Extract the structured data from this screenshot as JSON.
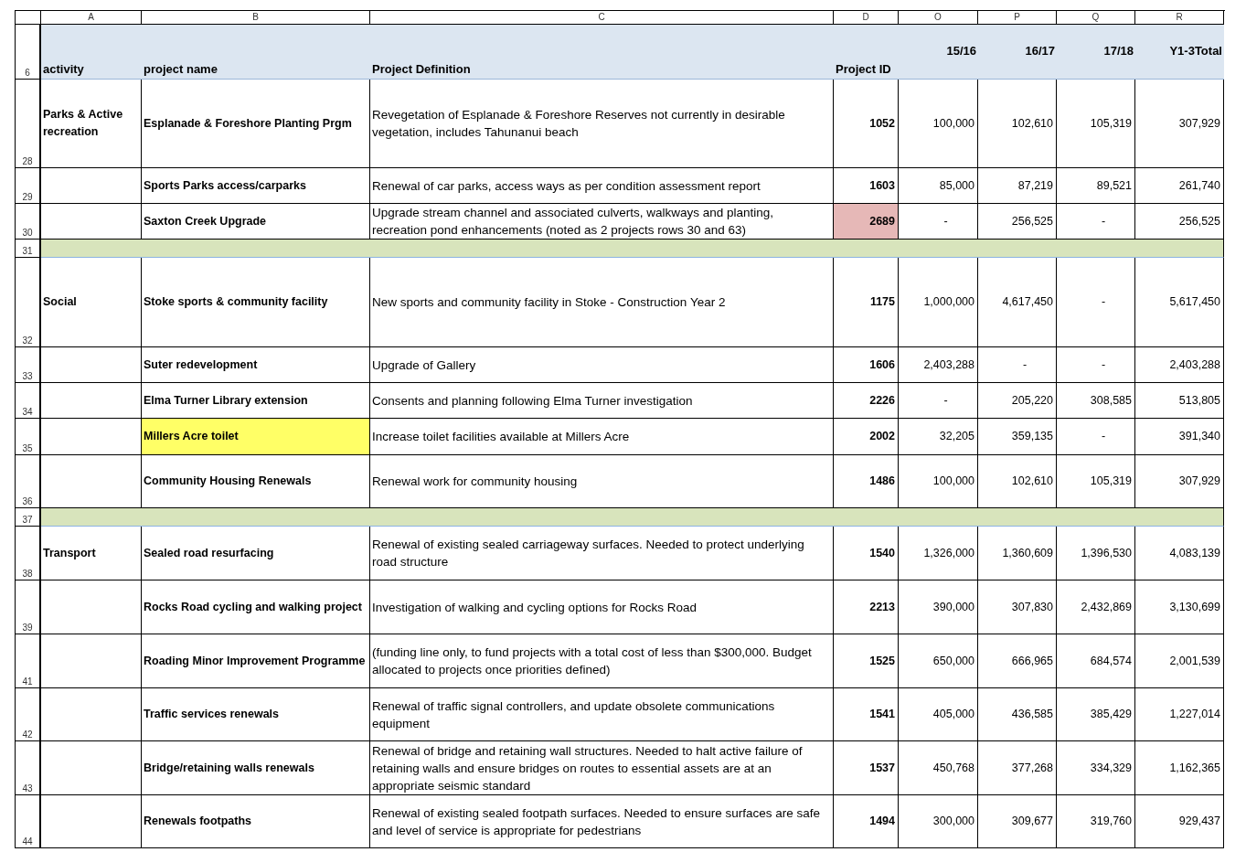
{
  "column_letters": [
    "A",
    "B",
    "C",
    "D",
    "O",
    "P",
    "Q",
    "R"
  ],
  "header": {
    "number": "6",
    "labels": [
      "activity",
      "project name",
      "Project Definition",
      "Project ID"
    ],
    "years": [
      "15/16",
      "16/17",
      "17/18",
      "Y1-3Total"
    ]
  },
  "rows": [
    {
      "kind": "data",
      "number": "28",
      "activity": "Parks & Active recreation",
      "project": {
        "text": "Esplanade & Foreshore Planting Prgm"
      },
      "definition": "Revegetation of Esplanade & Foreshore Reserves not currently in desirable vegetation, includes Tahunanui beach",
      "project_id": {
        "text": "1052"
      },
      "amounts": [
        "100,000",
        "102,610",
        "105,319",
        "307,929"
      ]
    },
    {
      "kind": "data",
      "number": "29",
      "project": {
        "text": "Sports Parks access/carparks"
      },
      "definition": "Renewal of car parks, access ways as per condition assessment report",
      "project_id": {
        "text": "1603"
      },
      "amounts": [
        "85,000",
        "87,219",
        "89,521",
        "261,740"
      ]
    },
    {
      "kind": "data",
      "number": "30",
      "project": {
        "text": "Saxton Creek Upgrade"
      },
      "definition": "Upgrade stream channel and associated culverts, walkways and planting, recreation pond enhancements (noted as 2 projects rows 30 and 63)",
      "project_id": {
        "text": "2689",
        "color": "#e6b8b7"
      },
      "amounts": [
        "-",
        "256,525",
        "-",
        "256,525"
      ]
    },
    {
      "kind": "separator",
      "number": "31"
    },
    {
      "kind": "data",
      "number": "32",
      "activity": "Social",
      "project": {
        "text": "Stoke sports & community facility"
      },
      "definition": "New sports and community facility in Stoke - Construction Year 2",
      "project_id": {
        "text": "1175"
      },
      "amounts": [
        "1,000,000",
        "4,617,450",
        "-",
        "5,617,450"
      ]
    },
    {
      "kind": "data",
      "number": "33",
      "project": {
        "text": "Suter redevelopment"
      },
      "definition": "Upgrade of Gallery",
      "project_id": {
        "text": "1606"
      },
      "amounts": [
        "2,403,288",
        "-",
        "-",
        "2,403,288"
      ]
    },
    {
      "kind": "data",
      "number": "34",
      "project": {
        "text": "Elma Turner Library extension"
      },
      "definition": "Consents and planning following Elma Turner investigation",
      "project_id": {
        "text": "2226"
      },
      "amounts": [
        "-",
        "205,220",
        "308,585",
        "513,805"
      ]
    },
    {
      "kind": "data",
      "number": "35",
      "project": {
        "text": "Millers Acre toilet",
        "color": "#ffff66"
      },
      "definition": "Increase toilet facilities available at Millers Acre",
      "project_id": {
        "text": "2002"
      },
      "amounts": [
        "32,205",
        "359,135",
        "-",
        "391,340"
      ]
    },
    {
      "kind": "data",
      "number": "36",
      "project": {
        "text": "Community Housing Renewals"
      },
      "definition": "Renewal work for community housing",
      "project_id": {
        "text": "1486"
      },
      "amounts": [
        "100,000",
        "102,610",
        "105,319",
        "307,929"
      ]
    },
    {
      "kind": "separator",
      "number": "37"
    },
    {
      "kind": "data",
      "number": "38",
      "activity": "Transport",
      "project": {
        "text": "Sealed road resurfacing"
      },
      "definition": "Renewal of existing sealed carriageway surfaces. Needed to protect underlying road structure",
      "project_id": {
        "text": "1540"
      },
      "amounts": [
        "1,326,000",
        "1,360,609",
        "1,396,530",
        "4,083,139"
      ]
    },
    {
      "kind": "data",
      "number": "39",
      "project": {
        "text": "Rocks Road cycling and walking project"
      },
      "definition": "Investigation of walking and cycling options for Rocks Road",
      "project_id": {
        "text": "2213"
      },
      "amounts": [
        "390,000",
        "307,830",
        "2,432,869",
        "3,130,699"
      ]
    },
    {
      "kind": "data",
      "number": "41",
      "project": {
        "text": "Roading Minor Improvement Programme"
      },
      "definition": "(funding line only, to fund projects with a total cost of less than $300,000. Budget allocated to projects once priorities defined)",
      "project_id": {
        "text": "1525"
      },
      "amounts": [
        "650,000",
        "666,965",
        "684,574",
        "2,001,539"
      ]
    },
    {
      "kind": "data",
      "number": "42",
      "project": {
        "text": "Traffic services renewals"
      },
      "definition": "Renewal of traffic signal controllers, and update obsolete communications equipment",
      "project_id": {
        "text": "1541"
      },
      "amounts": [
        "405,000",
        "436,585",
        "385,429",
        "1,227,014"
      ]
    },
    {
      "kind": "data",
      "number": "43",
      "project": {
        "text": "Bridge/retaining walls renewals"
      },
      "definition": "Renewal of bridge and retaining wall structures. Needed to halt active failure of retaining walls and ensure bridges on routes to essential assets are at an appropriate seismic standard",
      "project_id": {
        "text": "1537"
      },
      "amounts": [
        "450,768",
        "377,268",
        "334,329",
        "1,162,365"
      ]
    },
    {
      "kind": "data",
      "number": "44",
      "project": {
        "text": "Renewals footpaths"
      },
      "definition": "Renewal of existing sealed footpath surfaces. Needed to ensure surfaces are safe and level of service is appropriate for pedestrians",
      "project_id": {
        "text": "1494"
      },
      "amounts": [
        "300,000",
        "309,677",
        "319,760",
        "929,437"
      ]
    }
  ]
}
